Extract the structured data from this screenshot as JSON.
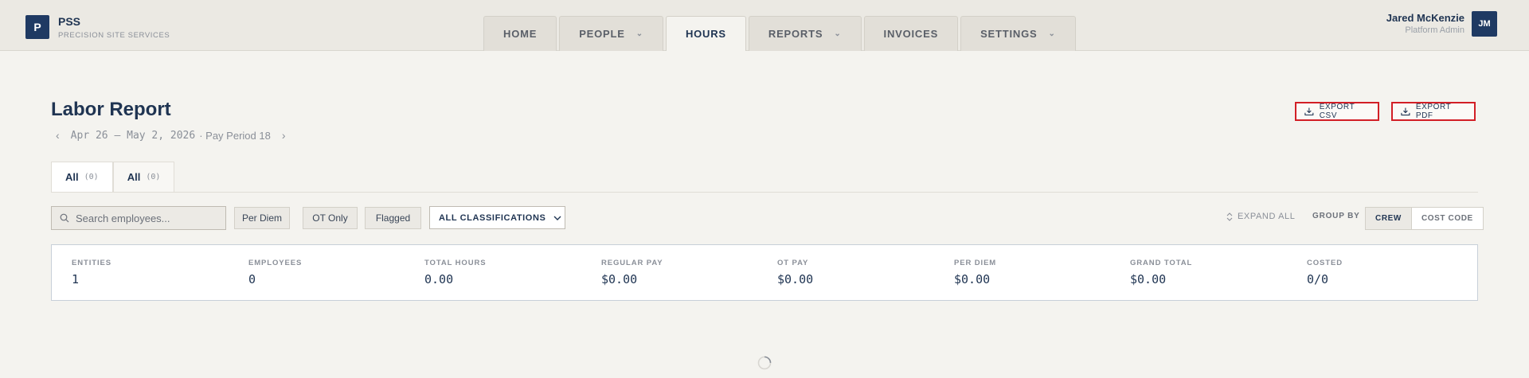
{
  "brand": {
    "mark": "P",
    "name": "PSS",
    "subtitle": "PRECISION SITE SERVICES"
  },
  "nav": {
    "tabs": [
      {
        "label": "HOME",
        "dropdown": false
      },
      {
        "label": "PEOPLE",
        "dropdown": true
      },
      {
        "label": "HOURS",
        "dropdown": false,
        "active": true
      },
      {
        "label": "REPORTS",
        "dropdown": true
      },
      {
        "label": "INVOICES",
        "dropdown": false
      },
      {
        "label": "SETTINGS",
        "dropdown": true
      }
    ]
  },
  "user": {
    "name": "Jared McKenzie",
    "role": "Platform Admin",
    "initials": "JM"
  },
  "header": {
    "title": "Labor Report",
    "date_range": "Apr 26 – May 2, 2026",
    "pay_period": "· Pay Period 18",
    "export_csv": "EXPORT CSV",
    "export_pdf": "EXPORT PDF"
  },
  "filter_tabs": [
    {
      "label": "All",
      "count": "(0)"
    },
    {
      "label": "All",
      "count": "(0)"
    }
  ],
  "toolbar": {
    "search_placeholder": "Search employees...",
    "chip_per_diem": "Per Diem",
    "chip_ot_only": "OT Only",
    "chip_flagged": "Flagged",
    "classification": "ALL CLASSIFICATIONS",
    "expand_all": "EXPAND ALL",
    "group_by": "GROUP BY",
    "group_crew": "CREW",
    "group_cost_code": "COST CODE"
  },
  "stats": [
    {
      "label": "ENTITIES",
      "value": "1"
    },
    {
      "label": "EMPLOYEES",
      "value": "0"
    },
    {
      "label": "TOTAL HOURS",
      "value": "0.00"
    },
    {
      "label": "REGULAR PAY",
      "value": "$0.00"
    },
    {
      "label": "OT PAY",
      "value": "$0.00"
    },
    {
      "label": "PER DIEM",
      "value": "$0.00"
    },
    {
      "label": "GRAND TOTAL",
      "value": "$0.00"
    },
    {
      "label": "COSTED",
      "value": "0/0"
    }
  ],
  "colors": {
    "navy": "#1f3a63",
    "accent_red": "#d21f26",
    "background": "#f4f3ef"
  }
}
